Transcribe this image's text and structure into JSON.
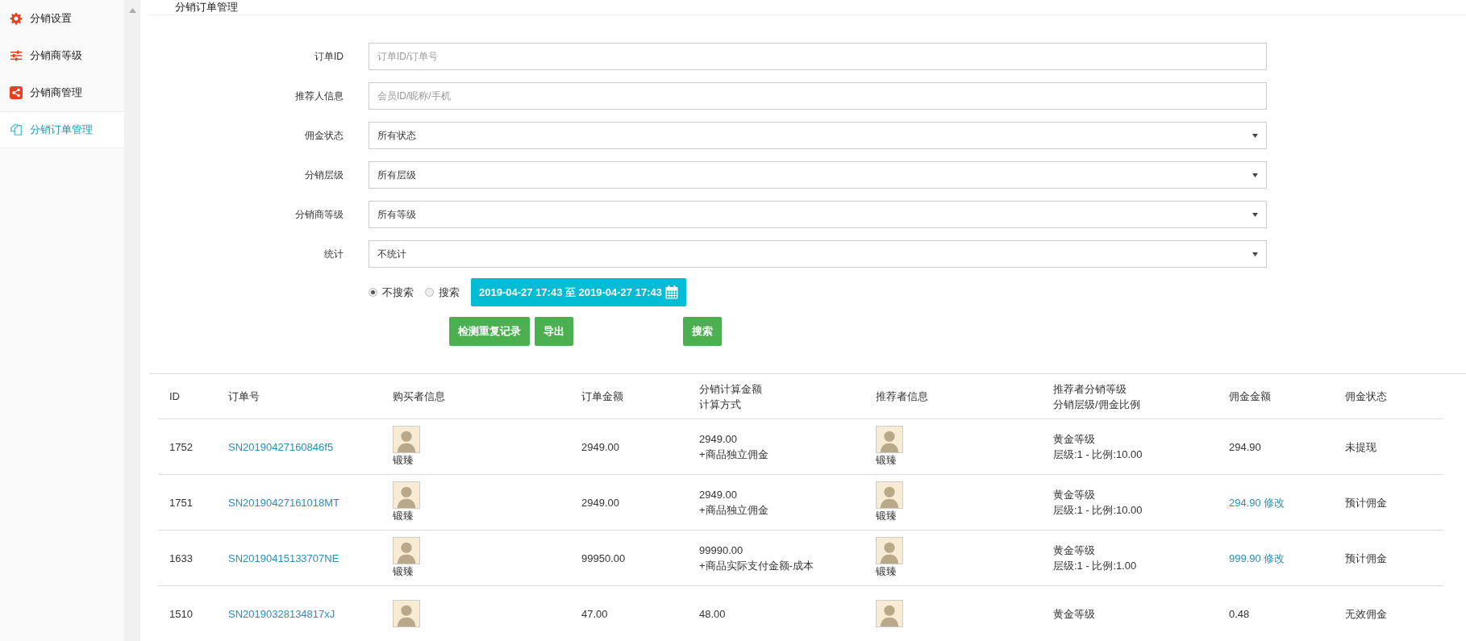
{
  "sidebar": {
    "items": [
      {
        "label": "分销设置",
        "kind": "gear",
        "selected": false
      },
      {
        "label": "分销商等级",
        "kind": "sliders",
        "selected": false
      },
      {
        "label": "分销商管理",
        "kind": "share",
        "selected": false
      },
      {
        "label": "分销订单管理",
        "kind": "pages",
        "selected": true
      }
    ]
  },
  "page_title": "分销订单管理",
  "filters": [
    {
      "label": "订单ID",
      "kind": "input",
      "placeholder": "订单ID/订单号"
    },
    {
      "label": "推荐人信息",
      "kind": "input",
      "placeholder": "会员ID/昵称/手机"
    },
    {
      "label": "佣金状态",
      "kind": "select",
      "value": "所有状态"
    },
    {
      "label": "分销层级",
      "kind": "select",
      "value": "所有层级"
    },
    {
      "label": "分销商等级",
      "kind": "select",
      "value": "所有等级"
    },
    {
      "label": "统计",
      "kind": "select",
      "value": "不统计"
    }
  ],
  "time_options": [
    {
      "label": "不搜索",
      "selected": true
    },
    {
      "label": "搜索",
      "selected": false
    }
  ],
  "date_range": "2019-04-27 17:43 至 2019-04-27 17:43",
  "buttons": {
    "check_duplicates": "检测重复记录",
    "export": "导出",
    "search": "搜索"
  },
  "table": {
    "columns": [
      [
        "ID"
      ],
      [
        "订单号"
      ],
      [
        "购买者信息"
      ],
      [
        "订单金额"
      ],
      [
        "分销计算金额",
        "计算方式"
      ],
      [
        "推荐者信息"
      ],
      [
        "推荐者分销等级",
        "分销层级/佣金比例"
      ],
      [
        "佣金金额"
      ],
      [
        "佣金状态"
      ]
    ],
    "rows": [
      {
        "id": "1752",
        "order_no": "SN20190427160846f5",
        "buyer": "锻臻",
        "order_amount": "2949.00",
        "calc_amount": "2949.00",
        "calc_method": "+商品独立佣金",
        "referrer": "锻臻",
        "level": "黄金等级",
        "ratio": "层级:1 - 比例:10.00",
        "commission": "294.90",
        "editable": false,
        "status": "未提现"
      },
      {
        "id": "1751",
        "order_no": "SN20190427161018MT",
        "buyer": "锻臻",
        "order_amount": "2949.00",
        "calc_amount": "2949.00",
        "calc_method": "+商品独立佣金",
        "referrer": "锻臻",
        "level": "黄金等级",
        "ratio": "层级:1 - 比例:10.00",
        "commission": "294.90",
        "editable": true,
        "edit_label": "修改",
        "status": "预计佣金"
      },
      {
        "id": "1633",
        "order_no": "SN20190415133707NE",
        "buyer": "锻臻",
        "order_amount": "99950.00",
        "calc_amount": "99990.00",
        "calc_method": "+商品实际支付金额-成本",
        "referrer": "锻臻",
        "level": "黄金等级",
        "ratio": "层级:1 - 比例:1.00",
        "commission": "999.90",
        "editable": true,
        "edit_label": "修改",
        "status": "预计佣金"
      },
      {
        "id": "1510",
        "order_no": "SN20190328134817xJ",
        "order_amount": "47.00",
        "calc_amount": "48.00",
        "level": "黄金等级",
        "commission": "0.48",
        "editable": false,
        "status": "无效佣金"
      }
    ]
  }
}
